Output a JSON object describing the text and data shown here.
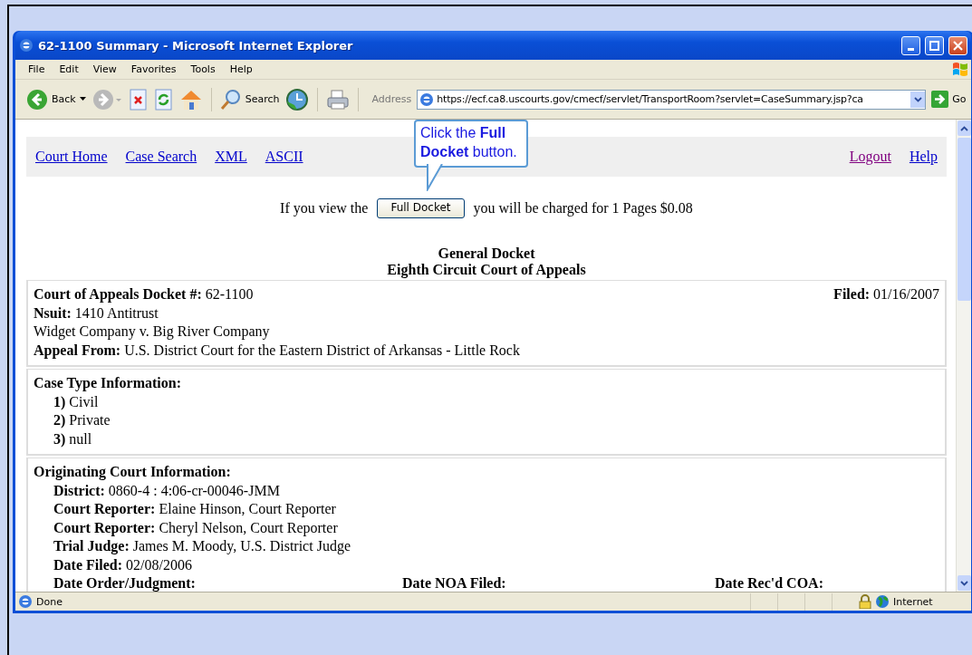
{
  "window": {
    "title": "62-1100 Summary - Microsoft Internet Explorer"
  },
  "menu": [
    {
      "label": "File"
    },
    {
      "label": "Edit"
    },
    {
      "label": "View"
    },
    {
      "label": "Favorites"
    },
    {
      "label": "Tools"
    },
    {
      "label": "Help"
    }
  ],
  "toolbar": {
    "back": "Back",
    "search": "Search",
    "address_label": "Address",
    "url": "https://ecf.ca8.uscourts.gov/cmecf/servlet/TransportRoom?servlet=CaseSummary.jsp?ca",
    "go": "Go"
  },
  "nav_links": [
    {
      "label": "Court Home",
      "visited": false
    },
    {
      "label": "Case Search",
      "visited": false
    },
    {
      "label": "XML",
      "visited": false
    },
    {
      "label": "ASCII",
      "visited": false
    }
  ],
  "nav_right": [
    {
      "label": "Logout",
      "visited": true
    },
    {
      "label": "Help",
      "visited": false
    }
  ],
  "callout": "Click the **Full Docket** button.",
  "charge": {
    "prefix": "If you view the",
    "button": "Full Docket",
    "suffix": "you will be charged for 1 Pages $0.08"
  },
  "heading": [
    "General Docket",
    "Eighth Circuit Court of Appeals"
  ],
  "sections": [
    {
      "title": "Court of Appeals Docket #:",
      "indented": false,
      "title_value": "62-1100",
      "right_label": "Filed:",
      "right_value": "01/16/2007",
      "lines": [
        {
          "label": "Nsuit:",
          "value": "1410 Antitrust"
        },
        {
          "value": "Widget Company v. Big River Company"
        },
        {
          "label": "Appeal From:",
          "value": "U.S. District Court for the Eastern District of Arkansas - Little Rock"
        }
      ]
    },
    {
      "title": "Case Type Information:",
      "indented": true,
      "lines": [
        {
          "label": "1)",
          "value": "Civil"
        },
        {
          "label": "2)",
          "value": "Private"
        },
        {
          "label": "3)",
          "value": "null"
        }
      ]
    },
    {
      "title": "Originating Court Information:",
      "indented": true,
      "lines": [
        {
          "label": "District:",
          "value": "0860-4 : 4:06-cr-00046-JMM"
        },
        {
          "label": "Court Reporter:",
          "value": "Elaine Hinson, Court Reporter"
        },
        {
          "label": "Court Reporter:",
          "value": "Cheryl Nelson, Court Reporter"
        },
        {
          "label": "Trial Judge:",
          "value": "James M. Moody, U.S. District Judge"
        },
        {
          "label": "Date Filed:",
          "value": "02/08/2006"
        }
      ],
      "columns": [
        "Date Order/Judgment:",
        "Date NOA Filed:",
        "Date Rec'd COA:"
      ]
    }
  ],
  "status": {
    "text": "Done",
    "zone": "Internet"
  }
}
